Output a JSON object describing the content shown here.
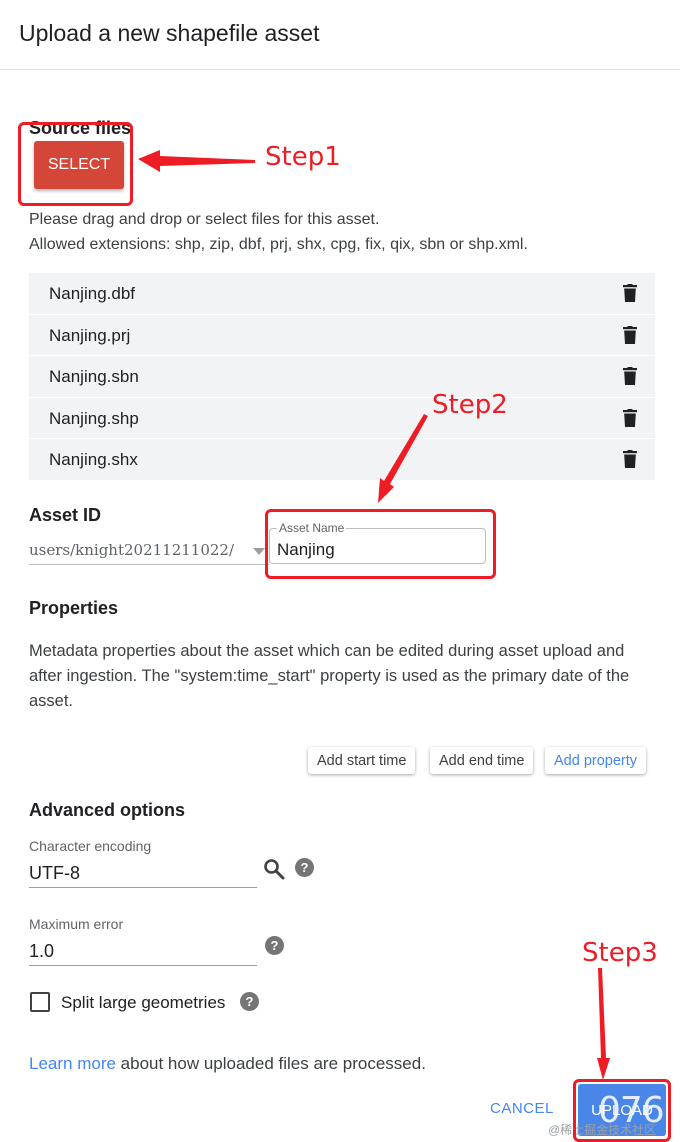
{
  "dialog": {
    "title": "Upload a new shapefile asset"
  },
  "source": {
    "heading": "Source files",
    "select_label": "SELECT",
    "help_line1": "Please drag and drop or select files for this asset.",
    "help_line2": "Allowed extensions: shp, zip, dbf, prj, shx, cpg, fix, qix, sbn or shp.xml.",
    "files": [
      "Nanjing.dbf",
      "Nanjing.prj",
      "Nanjing.sbn",
      "Nanjing.shp",
      "Nanjing.shx"
    ]
  },
  "asset_id": {
    "heading": "Asset ID",
    "prefix": "users/knight20211211022/",
    "name_label": "Asset Name",
    "name_value": "Nanjing"
  },
  "properties": {
    "heading": "Properties",
    "description": "Metadata properties about the asset which can be edited during asset upload and after ingestion. The \"system:time_start\" property is used as the primary date of the asset.",
    "add_start": "Add start time",
    "add_end": "Add end time",
    "add_property": "Add property"
  },
  "advanced": {
    "heading": "Advanced options",
    "encoding_label": "Character encoding",
    "encoding_value": "UTF-8",
    "max_error_label": "Maximum error",
    "max_error_value": "1.0",
    "split_label": "Split large geometries",
    "help_glyph": "?"
  },
  "footer": {
    "learn_link": "Learn more",
    "learn_rest": " about how uploaded files are processed.",
    "cancel": "CANCEL",
    "upload": "UPLOAD",
    "overlay_text": "076",
    "watermark": "@稀土掘金技术社区"
  },
  "annotations": {
    "step1": "Step1",
    "step2": "Step2",
    "step3": "Step3",
    "color": "#ee1c24"
  }
}
